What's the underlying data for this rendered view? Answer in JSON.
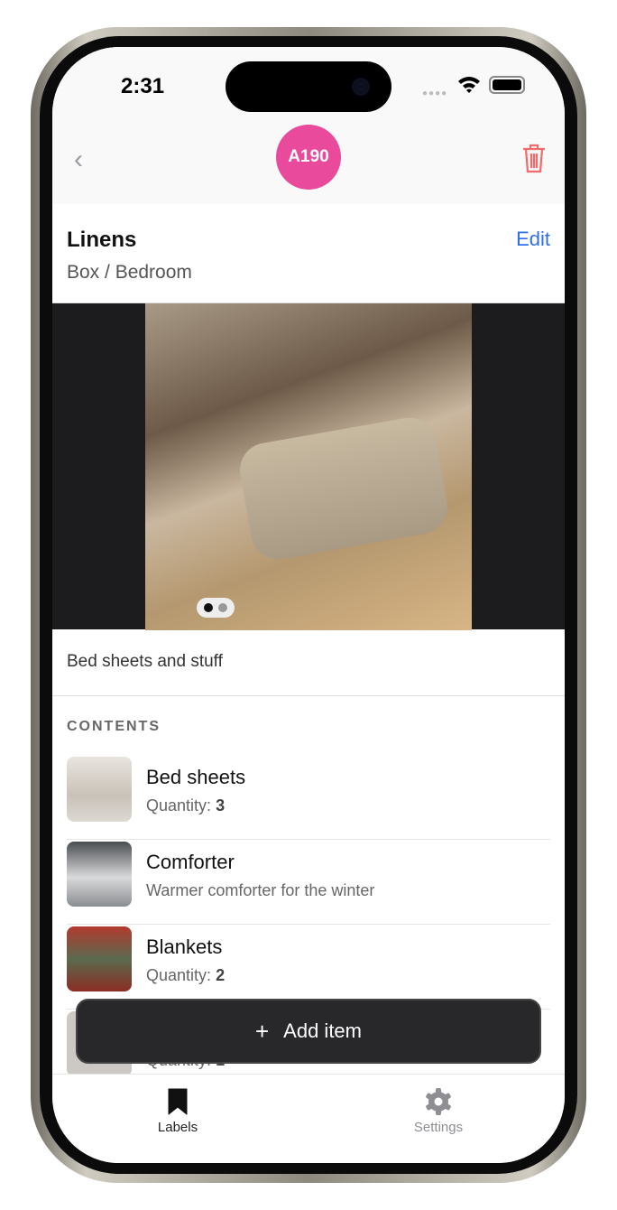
{
  "status_bar": {
    "time": "2:31"
  },
  "header": {
    "badge": "A190",
    "back_icon": "chevron-left-icon",
    "delete_icon": "trash-icon",
    "accent": "#ea4a9b",
    "delete_color": "#f26b6b"
  },
  "label": {
    "title": "Linens",
    "edit": "Edit",
    "path": "Box / Bedroom",
    "description": "Bed sheets and stuff",
    "photo_count": 2,
    "photo_index": 1
  },
  "contents": {
    "heading": "CONTENTS",
    "items": [
      {
        "name": "Bed sheets",
        "sub_label": "Quantity:",
        "sub_value": "3"
      },
      {
        "name": "Comforter",
        "sub_label": "Warmer comforter for the winter",
        "sub_value": ""
      },
      {
        "name": "Blankets",
        "sub_label": "Quantity:",
        "sub_value": "2"
      },
      {
        "name": "",
        "sub_label": "Quantity:",
        "sub_value": "1"
      }
    ]
  },
  "add_button": {
    "label": "Add item",
    "icon": "plus-icon"
  },
  "tabs": [
    {
      "label": "Labels",
      "icon": "bookmark-icon",
      "active": true
    },
    {
      "label": "Settings",
      "icon": "gear-icon",
      "active": false
    }
  ]
}
